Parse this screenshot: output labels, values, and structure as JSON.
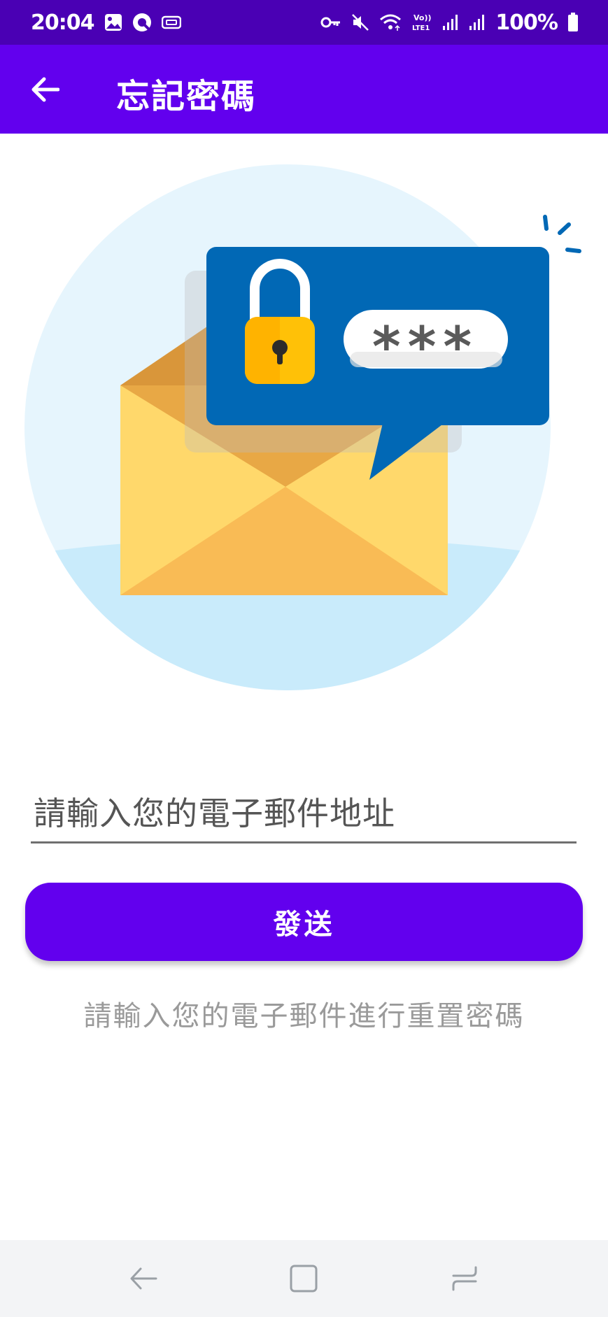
{
  "status_bar": {
    "time": "20:04",
    "battery": "100%",
    "left_icons": [
      "gallery-icon",
      "q-app-icon",
      "cast-icon"
    ],
    "right_icons": [
      "key-icon",
      "mute-icon",
      "wifi-icon",
      "volte-icon",
      "signal-icon",
      "signal-icon-2",
      "battery-icon"
    ],
    "volte_label": "Vo)) LTE1"
  },
  "app_bar": {
    "title": "忘記密碼",
    "background": "#6200ee",
    "back_icon": "arrow-back-icon"
  },
  "illustration": {
    "password_mask": "***",
    "lock_icon": "padlock-icon",
    "envelope_icon": "envelope-icon"
  },
  "form": {
    "email_placeholder": "請輸入您的電子郵件地址",
    "email_value": "",
    "send_label": "發送",
    "hint": "請輸入您的電子郵件進行重置密碼"
  },
  "nav_bar": {
    "back_icon": "nav-back-icon",
    "home_icon": "nav-home-icon",
    "recents_icon": "nav-recents-icon"
  },
  "colors": {
    "primary": "#6200ee",
    "status_bar": "#4a00b4",
    "hint": "#9a9a9a"
  }
}
